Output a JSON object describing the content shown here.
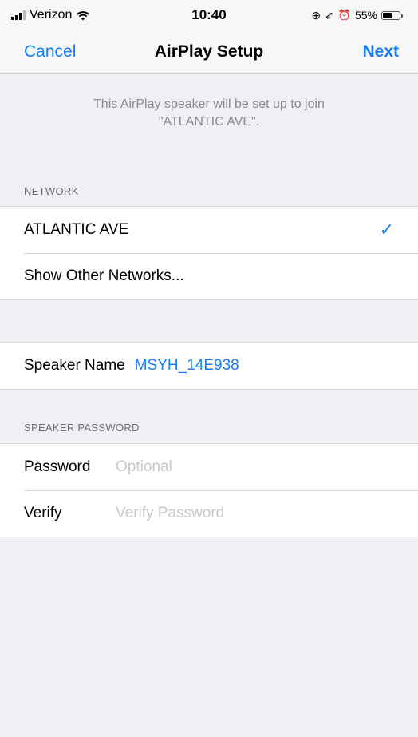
{
  "status_bar": {
    "carrier": "Verizon",
    "time": "10:40",
    "battery": "55%"
  },
  "nav": {
    "cancel": "Cancel",
    "title": "AirPlay Setup",
    "next": "Next"
  },
  "info": {
    "line1": "This AirPlay speaker will be set up to join",
    "line2": "\"ATLANTIC AVE\"."
  },
  "network": {
    "header": "NETWORK",
    "selected": "ATLANTIC AVE",
    "other": "Show Other Networks..."
  },
  "speaker": {
    "label": "Speaker Name",
    "value": "MSYH_14E938"
  },
  "password": {
    "header": "SPEAKER PASSWORD",
    "password_label": "Password",
    "password_placeholder": "Optional",
    "verify_label": "Verify",
    "verify_placeholder": "Verify Password"
  },
  "icons": {
    "checkmark": "checkmark-icon",
    "wifi": "wifi-icon",
    "battery": "battery-icon"
  },
  "colors": {
    "accent": "#147efb",
    "background": "#efeff4"
  }
}
